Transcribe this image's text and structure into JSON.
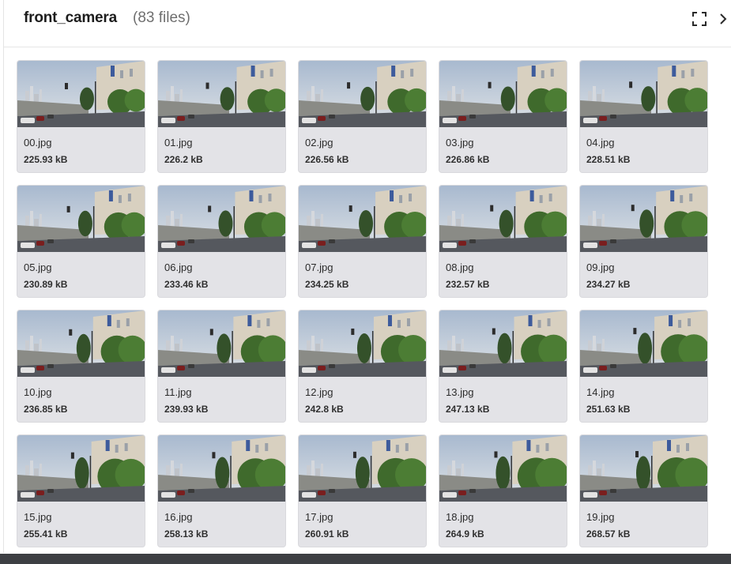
{
  "header": {
    "title": "front_camera",
    "count": "(83 files)",
    "expand_icon": "expand-icon",
    "next_icon": "chevron-right-icon"
  },
  "files": [
    {
      "name": "00.jpg",
      "size": "225.93 kB"
    },
    {
      "name": "01.jpg",
      "size": "226.2 kB"
    },
    {
      "name": "02.jpg",
      "size": "226.56 kB"
    },
    {
      "name": "03.jpg",
      "size": "226.86 kB"
    },
    {
      "name": "04.jpg",
      "size": "228.51 kB"
    },
    {
      "name": "05.jpg",
      "size": "230.89 kB"
    },
    {
      "name": "06.jpg",
      "size": "233.46 kB"
    },
    {
      "name": "07.jpg",
      "size": "234.25 kB"
    },
    {
      "name": "08.jpg",
      "size": "232.57 kB"
    },
    {
      "name": "09.jpg",
      "size": "234.27 kB"
    },
    {
      "name": "10.jpg",
      "size": "236.85 kB"
    },
    {
      "name": "11.jpg",
      "size": "239.93 kB"
    },
    {
      "name": "12.jpg",
      "size": "242.8 kB"
    },
    {
      "name": "13.jpg",
      "size": "247.13 kB"
    },
    {
      "name": "14.jpg",
      "size": "251.63 kB"
    },
    {
      "name": "15.jpg",
      "size": "255.41 kB"
    },
    {
      "name": "16.jpg",
      "size": "258.13 kB"
    },
    {
      "name": "17.jpg",
      "size": "260.91 kB"
    },
    {
      "name": "18.jpg",
      "size": "264.9 kB"
    },
    {
      "name": "19.jpg",
      "size": "268.57 kB"
    }
  ],
  "colors": {
    "sky": "#b7c3d4",
    "building": "#d8d0c0",
    "tree": "#3f6a2c",
    "road": "#55585e"
  }
}
